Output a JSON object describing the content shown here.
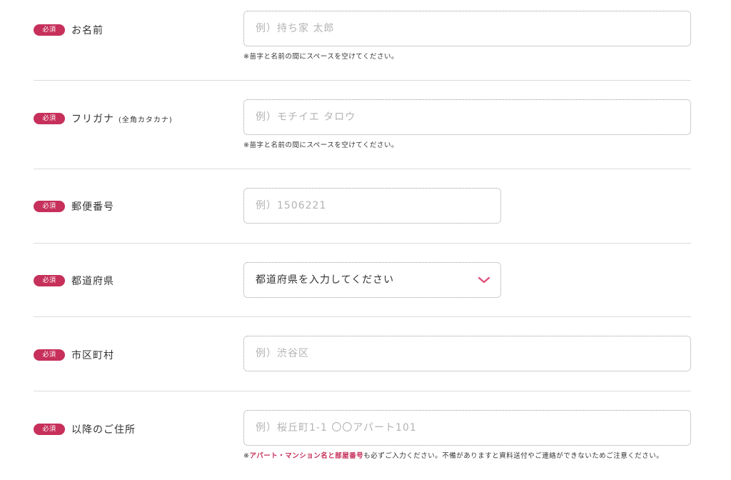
{
  "required_badge": "必須",
  "rows": [
    {
      "label": "お名前",
      "placeholder": "例）持ち家 太郎",
      "note": "※苗字と名前の間にスペースを空けてください。"
    },
    {
      "label": "フリガナ",
      "label_sub": "(全角カタカナ)",
      "placeholder": "例）モチイエ タロウ",
      "note": "※苗字と名前の間にスペースを空けてください。"
    },
    {
      "label": "郵便番号",
      "placeholder": "例）1506221"
    },
    {
      "label": "都道府県",
      "select_value": "都道府県を入力してください",
      "chevron_icon": "chevron-down-icon"
    },
    {
      "label": "市区町村",
      "placeholder": "例）渋谷区"
    },
    {
      "label": "以降のご住所",
      "placeholder": "例）桜丘町1-1 〇〇アパート101",
      "note_prefix": "※",
      "note_emphasis": "アパート・マンション名と部屋番号",
      "note_rest": "も必ずご入力ください。不備がありますと資料送付やご連絡ができないためご注意ください。"
    }
  ],
  "colors": {
    "badge": "#c6305a",
    "chevron": "#e0517c",
    "placeholder": "#b3b3b3",
    "divider": "#dcdcdc"
  }
}
